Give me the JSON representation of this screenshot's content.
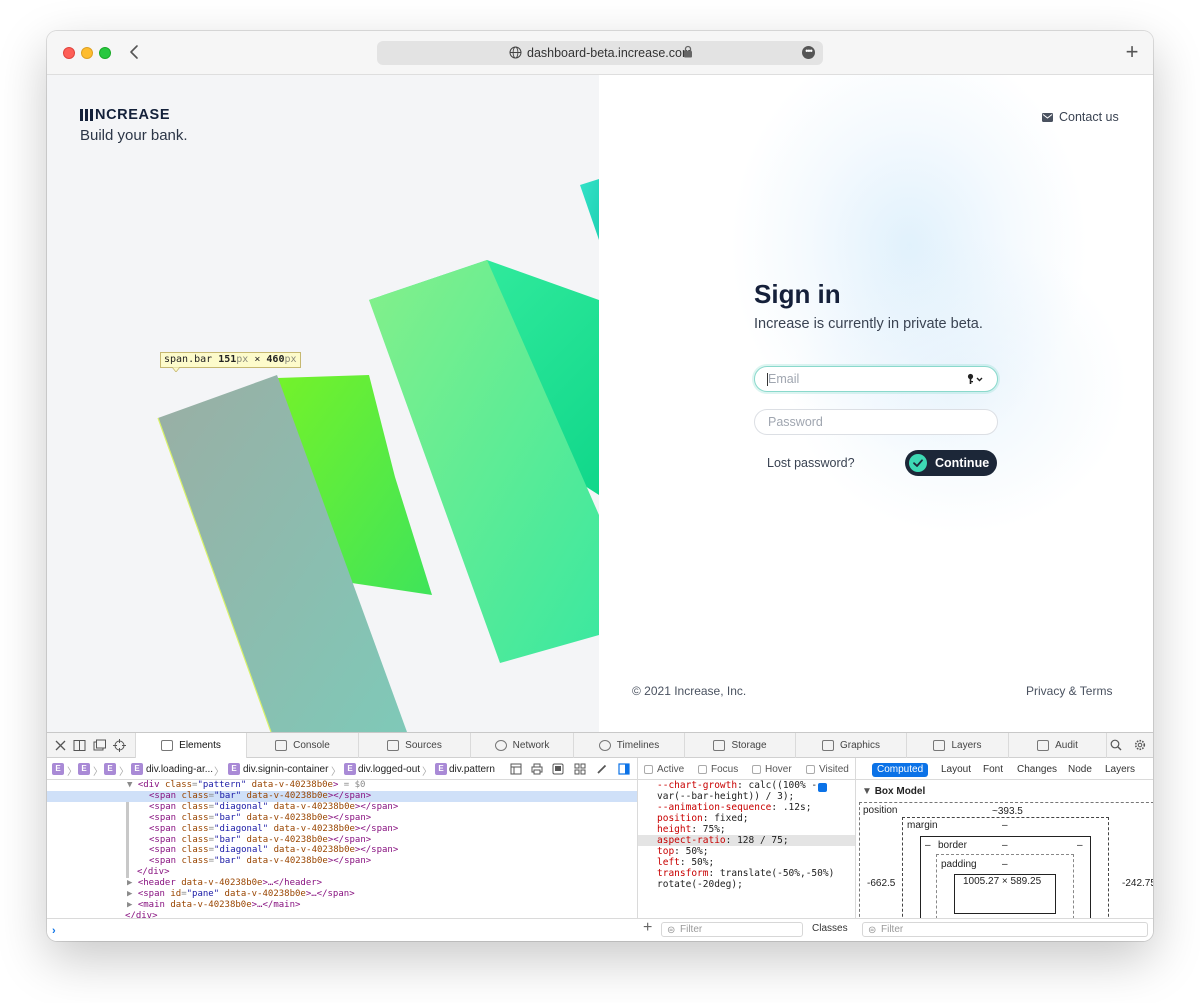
{
  "browser": {
    "url": "dashboard-beta.increase.com",
    "more_glyph": "•••",
    "new_tab_glyph": "+"
  },
  "brand": {
    "logo_text": "NCREASE",
    "tagline": "Build your bank."
  },
  "inspector_tooltip": {
    "selector": "span.bar",
    "width": "151",
    "height": "460",
    "unit": "px",
    "times": "×"
  },
  "header": {
    "contact_label": "Contact us"
  },
  "signin": {
    "title": "Sign in",
    "subtitle": "Increase is currently in private beta.",
    "email_placeholder": "Email",
    "password_placeholder": "Password",
    "lost_password": "Lost password?",
    "continue_label": "Continue"
  },
  "footer": {
    "copyright": "© 2021 Increase, Inc.",
    "legal": "Privacy & Terms"
  },
  "colors": {
    "accent_teal": "#3dd9b4",
    "button_dark": "#1c2738",
    "pattern_green": "#6ef736",
    "pattern_mint": "#2ee6b5",
    "selection_blue": "#0b72e7"
  },
  "devtools": {
    "tabs": [
      "Elements",
      "Console",
      "Sources",
      "Network",
      "Timelines",
      "Storage",
      "Graphics",
      "Layers",
      "Audit"
    ],
    "active_tab": "Elements",
    "breadcrumb": [
      "E",
      "E",
      "E",
      "div.loading-ar...",
      "div.signin-container",
      "div.logged-out",
      "div.pattern"
    ],
    "breadcrumb_badge": "E",
    "dom_lines": [
      {
        "indent": 0,
        "arrow": "▼",
        "tag_open": "<div",
        "attr": "class",
        "val": "\"pattern\"",
        "extra": " data-v-40238b0e",
        "close": ">",
        "tail": " = $0"
      },
      {
        "indent": 1,
        "arrow": "",
        "tag_open": "<span",
        "attr": "class",
        "val": "\"bar\"",
        "extra": " data-v-40238b0e",
        "close": "></span>",
        "tail": ""
      },
      {
        "indent": 1,
        "arrow": "",
        "tag_open": "<span",
        "attr": "class",
        "val": "\"diagonal\"",
        "extra": " data-v-40238b0e",
        "close": "></span>",
        "tail": ""
      },
      {
        "indent": 1,
        "arrow": "",
        "tag_open": "<span",
        "attr": "class",
        "val": "\"bar\"",
        "extra": " data-v-40238b0e",
        "close": "></span>",
        "tail": ""
      },
      {
        "indent": 1,
        "arrow": "",
        "tag_open": "<span",
        "attr": "class",
        "val": "\"diagonal\"",
        "extra": " data-v-40238b0e",
        "close": "></span>",
        "tail": ""
      },
      {
        "indent": 1,
        "arrow": "",
        "tag_open": "<span",
        "attr": "class",
        "val": "\"bar\"",
        "extra": " data-v-40238b0e",
        "close": "></span>",
        "tail": ""
      },
      {
        "indent": 1,
        "arrow": "",
        "tag_open": "<span",
        "attr": "class",
        "val": "\"diagonal\"",
        "extra": " data-v-40238b0e",
        "close": "></span>",
        "tail": ""
      },
      {
        "indent": 1,
        "arrow": "",
        "tag_open": "<span",
        "attr": "class",
        "val": "\"bar\"",
        "extra": " data-v-40238b0e",
        "close": "></span>",
        "tail": ""
      },
      {
        "indent": 0,
        "arrow": "",
        "tag_open": "</div>",
        "attr": "",
        "val": "",
        "extra": "",
        "close": "",
        "tail": ""
      },
      {
        "indent": 0,
        "arrow": "▶",
        "tag_open": "<header",
        "attr": "",
        "val": "",
        "extra": " data-v-40238b0e",
        "close": ">…</header>",
        "tail": ""
      },
      {
        "indent": 0,
        "arrow": "▶",
        "tag_open": "<span",
        "attr": "id",
        "val": "\"pane\"",
        "extra": " data-v-40238b0e",
        "close": ">…</span>",
        "tail": ""
      },
      {
        "indent": 0,
        "arrow": "▶",
        "tag_open": "<main",
        "attr": "",
        "val": "",
        "extra": " data-v-40238b0e",
        "close": ">…</main>",
        "tail": ""
      },
      {
        "indent": -1,
        "arrow": "",
        "tag_open": "</div>",
        "attr": "",
        "val": "",
        "extra": "",
        "close": "",
        "tail": ""
      }
    ],
    "style_filters": [
      "Active",
      "Focus",
      "Hover",
      "Visited"
    ],
    "style_lines": [
      {
        "prop": "--chart-growth",
        "val": ": calc((100% -"
      },
      {
        "prop": "",
        "val": "var(--bar-height)) / 3);"
      },
      {
        "prop": "--animation-sequence",
        "val": ": .12s;"
      },
      {
        "prop": "position",
        "val": ": fixed;"
      },
      {
        "prop": "height",
        "val": ": 75%;"
      },
      {
        "prop": "aspect-ratio",
        "val": ": 128 / 75;"
      },
      {
        "prop": "top",
        "val": ": 50%;"
      },
      {
        "prop": "left",
        "val": ": 50%;"
      },
      {
        "prop": "transform",
        "val": ": translate(-50%,-50%)"
      },
      {
        "prop": "",
        "val": "rotate(-20deg);"
      }
    ],
    "computed_tabs": [
      "Computed",
      "Layout",
      "Font",
      "Changes",
      "Node",
      "Layers"
    ],
    "box_model": {
      "heading": "Box Model",
      "position_label": "position",
      "position_top": "~393.5",
      "margin_label": "margin",
      "border_label": "border",
      "padding_label": "padding",
      "dash": "–",
      "left_value": "-662.5",
      "right_value": "-242.75",
      "content_size": "1005.27 × 589.25"
    },
    "filter_placeholder": "Filter",
    "classes_label": "Classes"
  }
}
